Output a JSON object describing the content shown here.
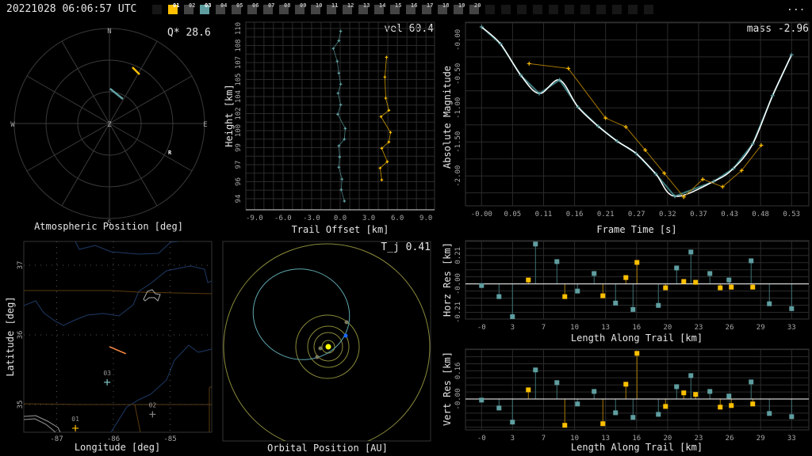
{
  "header": {
    "timestamp": "20221028 06:06:57 UTC",
    "more_label": "...",
    "stations": [
      {
        "id": "01",
        "color": "#ffc000",
        "active": true
      },
      {
        "id": "02",
        "color": "#444444"
      },
      {
        "id": "03",
        "color": "#5f9ea0",
        "active": true
      },
      {
        "id": "04",
        "color": "#444444"
      },
      {
        "id": "05",
        "color": "#444444"
      },
      {
        "id": "06",
        "color": "#444444"
      },
      {
        "id": "07",
        "color": "#444444"
      },
      {
        "id": "08",
        "color": "#444444"
      },
      {
        "id": "09",
        "color": "#444444"
      },
      {
        "id": "10",
        "color": "#444444"
      },
      {
        "id": "11",
        "color": "#444444"
      },
      {
        "id": "12",
        "color": "#444444"
      },
      {
        "id": "13",
        "color": "#444444"
      },
      {
        "id": "14",
        "color": "#444444"
      },
      {
        "id": "15",
        "color": "#444444"
      },
      {
        "id": "16",
        "color": "#444444"
      },
      {
        "id": "17",
        "color": "#444444"
      },
      {
        "id": "18",
        "color": "#444444"
      },
      {
        "id": "19",
        "color": "#444444"
      },
      {
        "id": "20",
        "color": "#444444"
      }
    ]
  },
  "colors": {
    "station1": "#ffc000",
    "station3": "#5f9ea0",
    "fit": "#ffffff",
    "track": "#ff8c42",
    "grid": "#2b2b2b"
  },
  "chart_data": [
    {
      "id": "polar",
      "type": "scatter",
      "title": "Atmospheric Position [deg]",
      "corner": "Q* 28.6",
      "cardinals": {
        "n": "N",
        "s": "S",
        "e": "E",
        "w": "W",
        "z": "Z"
      },
      "radiant_label": "R",
      "radiant": {
        "az": 116,
        "zd": 61.7
      },
      "series": [
        {
          "name": "03",
          "color": "#5f9ea0",
          "az": [
            1,
            28.7
          ],
          "zd": [
            33,
            26.5
          ]
        },
        {
          "name": "01",
          "color": "#ffc000",
          "az": [
            22.2,
            31.5
          ],
          "zd": [
            57.5,
            54.5
          ]
        }
      ]
    },
    {
      "id": "trail",
      "type": "line",
      "xlabel": "Trail Offset [km]",
      "ylabel": "Height [km]",
      "corner": "vel 60.4",
      "xticks": [
        -9,
        -6,
        -3,
        0,
        3,
        6,
        9
      ],
      "xtick_labels": [
        "-9.0",
        "-6.0",
        "-3.0",
        "0.0",
        "3.0",
        "6.0",
        "9.0"
      ],
      "yticks": [
        110,
        108.4,
        106.8,
        105.2,
        103.6,
        102,
        100.4,
        98.8,
        97.2,
        95.6,
        94
      ],
      "ytick_labels": [
        "110",
        "108",
        "107",
        "105",
        "104",
        "102",
        "100",
        "99",
        "97",
        "96",
        "94"
      ],
      "series": [
        {
          "name": "03",
          "color": "#5f9ea0",
          "x": [
            0.05,
            -0.14,
            -0.72,
            -0.31,
            -0.14,
            0.05,
            -0.22,
            0.05,
            -0.25,
            0.53,
            0.44,
            -0.14,
            -0.06,
            -0.14,
            0.19,
            0.11,
            0.44
          ],
          "y": [
            109.75,
            108.86,
            108.12,
            106.93,
            105.81,
            104.77,
            103.92,
            102.83,
            101.94,
            100.6,
            99.6,
            98.97,
            97.93,
            96.96,
            95.84,
            94.84,
            93.78
          ]
        },
        {
          "name": "01",
          "color": "#ffc000",
          "x": [
            4.86,
            4.69,
            4.78,
            5.11,
            4.28,
            5.28,
            5.11,
            4.36,
            4.94,
            4.19,
            4.36
          ],
          "y": [
            107.3,
            105.44,
            103.45,
            102.31,
            101.72,
            100.23,
            99.34,
            98.74,
            97.48,
            96.88,
            95.77
          ]
        }
      ]
    },
    {
      "id": "lightcurve",
      "type": "line",
      "xlabel": "Frame Time [s]",
      "ylabel": "Absolute Magnitude",
      "corner": "mass -2.96",
      "xticks": [
        0,
        0.053,
        0.106,
        0.159,
        0.212,
        0.265,
        0.318,
        0.371,
        0.424,
        0.477,
        0.53
      ],
      "xtick_labels": [
        "-0.00",
        "0.05",
        "0.11",
        "0.16",
        "0.21",
        "0.27",
        "0.32",
        "0.37",
        "0.43",
        "0.48",
        "0.53"
      ],
      "yticks": [
        -2,
        -1.5,
        -1,
        -0.5,
        0
      ],
      "ytick_labels": [
        "-2.00",
        "-1.50",
        "-1.00",
        "-0.50",
        "-0.00"
      ],
      "series": [
        {
          "name": "03",
          "color": "#5f9ea0",
          "x": [
            0,
            0.0325,
            0.067,
            0.0986,
            0.1334,
            0.165,
            0.1993,
            0.2318,
            0.2643,
            0.2978,
            0.3304,
            0.3972,
            0.4307,
            0.4636,
            0.4975,
            0.53
          ],
          "y": [
            0.19,
            -0.06,
            -0.52,
            -0.79,
            -0.59,
            -0.99,
            -1.27,
            -1.49,
            -1.67,
            -1.97,
            -2.3,
            -2.08,
            -1.89,
            -1.53,
            -0.82,
            -0.22
          ]
        },
        {
          "name": "01",
          "color": "#ffc000",
          "x": [
            0.0813,
            0.1483,
            0.212,
            0.2467,
            0.2798,
            0.3123,
            0.3457,
            0.3782,
            0.4121,
            0.4446,
            0.4781
          ],
          "y": [
            -0.35,
            -0.42,
            -1.15,
            -1.28,
            -1.62,
            -1.96,
            -2.31,
            -2.05,
            -2.16,
            -1.92,
            -1.55
          ]
        }
      ]
    },
    {
      "id": "horzres",
      "type": "scatter",
      "xlabel": "Length Along Trail [km]",
      "ylabel": "Horz Res [km]",
      "xticks": [
        0,
        3.3,
        6.6,
        9.9,
        13.2,
        16.5,
        19.8,
        23.1,
        26.4,
        29.7,
        33
      ],
      "xtick_labels": [
        "-0",
        "3",
        "7",
        "10",
        "13",
        "16",
        "20",
        "23",
        "26",
        "29",
        "33"
      ],
      "yticks": [
        0.21,
        0,
        -0.21
      ],
      "ytick_labels": [
        "0.21",
        "-0.00",
        "-0.21"
      ],
      "series": [
        {
          "name": "03",
          "color": "#5f9ea0",
          "x": [
            0,
            1.86,
            3.29,
            5.74,
            8.02,
            10.21,
            11.98,
            14.26,
            16.12,
            18.82,
            20.76,
            22.28,
            24.3,
            26.33,
            28.69,
            30.63,
            33.0
          ],
          "y": [
            -0.012,
            -0.094,
            -0.242,
            0.295,
            0.165,
            -0.053,
            0.077,
            -0.142,
            -0.189,
            -0.159,
            0.118,
            0.236,
            0.077,
            0.029,
            0.171,
            -0.147,
            -0.183
          ]
        },
        {
          "name": "01",
          "color": "#ffc000",
          "x": [
            4.98,
            8.86,
            12.91,
            15.36,
            16.54,
            19.58,
            21.52,
            22.78,
            25.4,
            26.58,
            28.86
          ],
          "y": [
            0.029,
            -0.094,
            -0.088,
            0.047,
            0.159,
            -0.029,
            0.018,
            0.012,
            -0.029,
            -0.024,
            -0.024
          ]
        }
      ]
    },
    {
      "id": "vertres",
      "type": "scatter",
      "xlabel": "Length Along Trail [km]",
      "ylabel": "Vert Res [km]",
      "xticks": [
        0,
        3.3,
        6.6,
        9.9,
        13.2,
        16.5,
        19.8,
        23.1,
        26.4,
        29.7,
        33
      ],
      "xtick_labels": [
        "-0",
        "3",
        "7",
        "10",
        "13",
        "16",
        "20",
        "23",
        "26",
        "29",
        "33"
      ],
      "yticks": [
        0.16,
        0
      ],
      "ytick_labels": [
        "0.16",
        "-0.00"
      ],
      "series": [
        {
          "name": "03",
          "color": "#5f9ea0",
          "x": [
            0,
            1.86,
            3.29,
            5.74,
            8.02,
            10.21,
            11.98,
            14.26,
            16.12,
            18.82,
            20.76,
            22.28,
            24.3,
            26.33,
            28.69,
            30.63,
            33.0
          ],
          "y": [
            -0.006,
            -0.051,
            -0.131,
            0.165,
            0.093,
            -0.028,
            0.043,
            -0.078,
            -0.104,
            -0.087,
            0.07,
            0.133,
            0.043,
            0.017,
            0.097,
            -0.082,
            -0.1
          ]
        },
        {
          "name": "01",
          "color": "#ffc000",
          "x": [
            4.98,
            8.86,
            12.91,
            15.36,
            16.54,
            19.58,
            21.52,
            22.78,
            25.4,
            26.58,
            28.86
          ],
          "y": [
            0.052,
            -0.149,
            -0.14,
            0.084,
            0.259,
            -0.042,
            0.035,
            0.026,
            -0.046,
            -0.037,
            -0.028
          ]
        }
      ]
    },
    {
      "id": "map",
      "type": "scatter",
      "xlabel": "Longitude [deg]",
      "ylabel": "Latitude [deg]",
      "xticks": [
        -87,
        -86,
        -85
      ],
      "xtick_labels": [
        "-87",
        "-86",
        "-85"
      ],
      "yticks": [
        37,
        36,
        35
      ],
      "ytick_labels": [
        "37",
        "36",
        "35"
      ],
      "stations": [
        {
          "label": "01",
          "lon": -86.67,
          "lat": 34.66,
          "color": "#ffc000"
        },
        {
          "label": "02",
          "lon": -85.31,
          "lat": 34.86,
          "color": "#888888"
        },
        {
          "label": "03",
          "lon": -86.11,
          "lat": 35.32,
          "color": "#7fc4c4"
        }
      ],
      "track": {
        "lon": [
          -86.07,
          -85.78
        ],
        "lat": [
          35.83,
          35.73
        ],
        "color": "#ff8c42"
      }
    },
    {
      "id": "orbit",
      "type": "scatter",
      "title": "Orbital Position [AU]",
      "corner": "T_j 0.41"
    }
  ]
}
